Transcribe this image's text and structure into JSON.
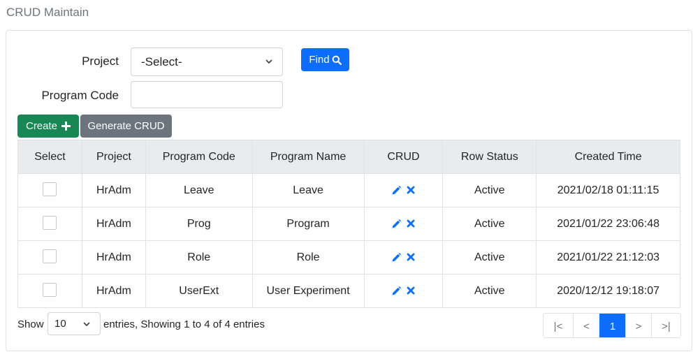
{
  "page": {
    "title": "CRUD Maintain"
  },
  "filters": {
    "project_label": "Project",
    "project_value": "-Select-",
    "program_code_label": "Program Code",
    "program_code_value": "",
    "find_label": "Find"
  },
  "toolbar": {
    "create_label": "Create",
    "generate_label": "Generate CRUD"
  },
  "table": {
    "columns": [
      "Select",
      "Project",
      "Program Code",
      "Program Name",
      "CRUD",
      "Row Status",
      "Created Time"
    ],
    "rows": [
      {
        "project": "HrAdm",
        "program_code": "Leave",
        "program_name": "Leave",
        "row_status": "Active",
        "created_time": "2021/02/18 01:11:15"
      },
      {
        "project": "HrAdm",
        "program_code": "Prog",
        "program_name": "Program",
        "row_status": "Active",
        "created_time": "2021/01/22 23:06:48"
      },
      {
        "project": "HrAdm",
        "program_code": "Role",
        "program_name": "Role",
        "row_status": "Active",
        "created_time": "2021/01/22 21:12:03"
      },
      {
        "project": "HrAdm",
        "program_code": "UserExt",
        "program_name": "User Experiment",
        "row_status": "Active",
        "created_time": "2020/12/12 19:18:07"
      }
    ]
  },
  "footer": {
    "show_label": "Show",
    "page_size": "10",
    "info": "entries, Showing 1 to 4 of 4 entries"
  },
  "pagination": {
    "first": "|<",
    "prev": "<",
    "current": "1",
    "next": ">",
    "last": ">|"
  },
  "colors": {
    "primary": "#0d6efd",
    "success": "#198754",
    "secondary": "#6c757d",
    "header_bg": "#e9ecef"
  },
  "icons": {
    "find": "search-icon",
    "create": "plus-icon",
    "edit": "pencil-icon",
    "delete": "close-icon"
  }
}
